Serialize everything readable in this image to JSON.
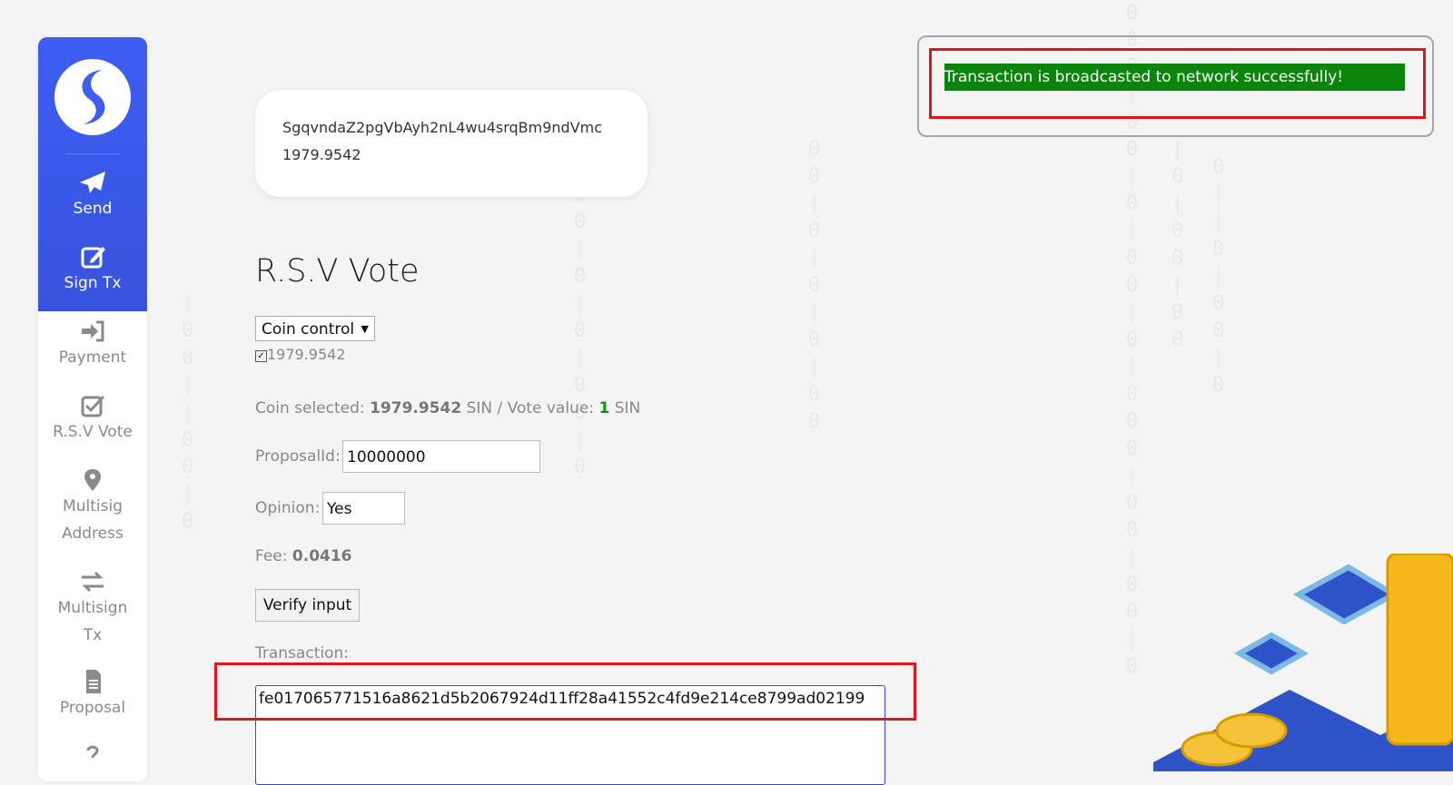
{
  "nav": {
    "send": "Send",
    "sign_tx": "Sign Tx",
    "payment": "Payment",
    "rsv_vote": "R.S.V Vote",
    "multisig_address_1": "Multisig",
    "multisig_address_2": "Address",
    "multisign_tx_1": "Multisign",
    "multisign_tx_2": "Tx",
    "proposal": "Proposal"
  },
  "wallet": {
    "address": "SgqvndaZ2pgVbAyh2nL4wu4srqBm9ndVmc",
    "balance": "1979.9542"
  },
  "page_title": "R.S.V Vote",
  "coin_control": {
    "selected": "Coin control",
    "coin_value": "1979.9542"
  },
  "summary": {
    "coin_selected_label": "Coin selected:",
    "coin_selected_value": "1979.9542",
    "unit1": "SIN / Vote value:",
    "vote_value": "1",
    "unit2": "SIN"
  },
  "proposal": {
    "label": "ProposalId:",
    "value": "10000000"
  },
  "opinion": {
    "label": "Opinion:",
    "value": "Yes"
  },
  "fee": {
    "label": "Fee:",
    "value": "0.0416"
  },
  "verify_button": "Verify input",
  "transaction": {
    "label": "Transaction:",
    "value": "fe017065771516a8621d5b2067924d11ff28a41552c4fd9e214ce8799ad02199"
  },
  "notification": "Transaction is broadcasted to network successfully!",
  "colors": {
    "sidebar_accent": "#3e5ef3",
    "success": "#0a840a",
    "highlight": "#e0141d"
  }
}
